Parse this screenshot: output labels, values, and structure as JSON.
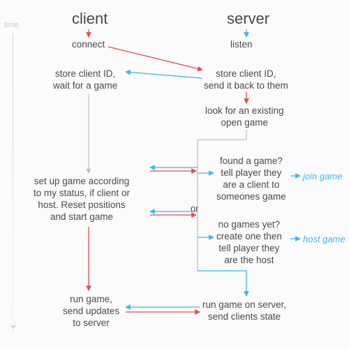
{
  "timeline_label": "time",
  "columns": {
    "client": "client",
    "server": "server"
  },
  "client": {
    "connect": "connect",
    "store": "store client ID,\nwait for a game",
    "setup": "set up game according\nto my status, if client or\nhost. Reset positions\nand start game",
    "run": "run game,\nsend updates\nto server"
  },
  "server": {
    "listen": "listen",
    "store": "store client ID,\nsend it back to them",
    "lookup": "look for an existing\nopen game",
    "found": "found a game?\ntell player they\nare a client to\nsomeones game",
    "nogame": "no games yet?\ncreate one then\ntell player they\nare the host",
    "run": "run game on server,\nsend clients state"
  },
  "or_label": "or",
  "annotations": {
    "join": "join\ngame",
    "host": "host\ngame"
  },
  "chart_data": {
    "type": "flow",
    "columns": [
      "client",
      "server"
    ],
    "nodes": [
      {
        "id": "c_connect",
        "col": "client",
        "label": "connect"
      },
      {
        "id": "c_store",
        "col": "client",
        "label": "store client ID, wait for a game"
      },
      {
        "id": "c_setup",
        "col": "client",
        "label": "set up game according to my status, if client or host. Reset positions and start game"
      },
      {
        "id": "c_run",
        "col": "client",
        "label": "run game, send updates to server"
      },
      {
        "id": "s_listen",
        "col": "server",
        "label": "listen"
      },
      {
        "id": "s_store",
        "col": "server",
        "label": "store client ID, send it back to them"
      },
      {
        "id": "s_lookup",
        "col": "server",
        "label": "look for an existing open game"
      },
      {
        "id": "s_found",
        "col": "server",
        "label": "found a game? tell player they are a client to someones game",
        "tag": "join game"
      },
      {
        "id": "s_nogame",
        "col": "server",
        "label": "no games yet? create one then tell player they are the host",
        "tag": "host game"
      },
      {
        "id": "s_run",
        "col": "server",
        "label": "run game on server, send clients state"
      }
    ],
    "edges": [
      {
        "from": "c_connect",
        "to": "s_store",
        "kind": "red"
      },
      {
        "from": "s_store",
        "to": "c_store",
        "kind": "blue"
      },
      {
        "from": "s_store",
        "to": "s_lookup",
        "kind": "red"
      },
      {
        "from": "s_lookup",
        "to": "s_found",
        "kind": "branch"
      },
      {
        "from": "s_lookup",
        "to": "s_nogame",
        "kind": "branch"
      },
      {
        "from": "s_found",
        "to": "c_setup",
        "kind": "blue"
      },
      {
        "from": "s_nogame",
        "to": "c_setup",
        "kind": "blue"
      },
      {
        "from": "c_setup",
        "to": "s_found",
        "kind": "red"
      },
      {
        "from": "c_setup",
        "to": "s_nogame",
        "kind": "red"
      },
      {
        "from": "c_setup",
        "to": "c_run",
        "kind": "red"
      },
      {
        "from": "c_run",
        "to": "s_run",
        "kind": "red"
      },
      {
        "from": "s_run",
        "to": "c_run",
        "kind": "blue"
      },
      {
        "from": "s_nogame",
        "to": "s_run",
        "kind": "blue"
      }
    ]
  }
}
